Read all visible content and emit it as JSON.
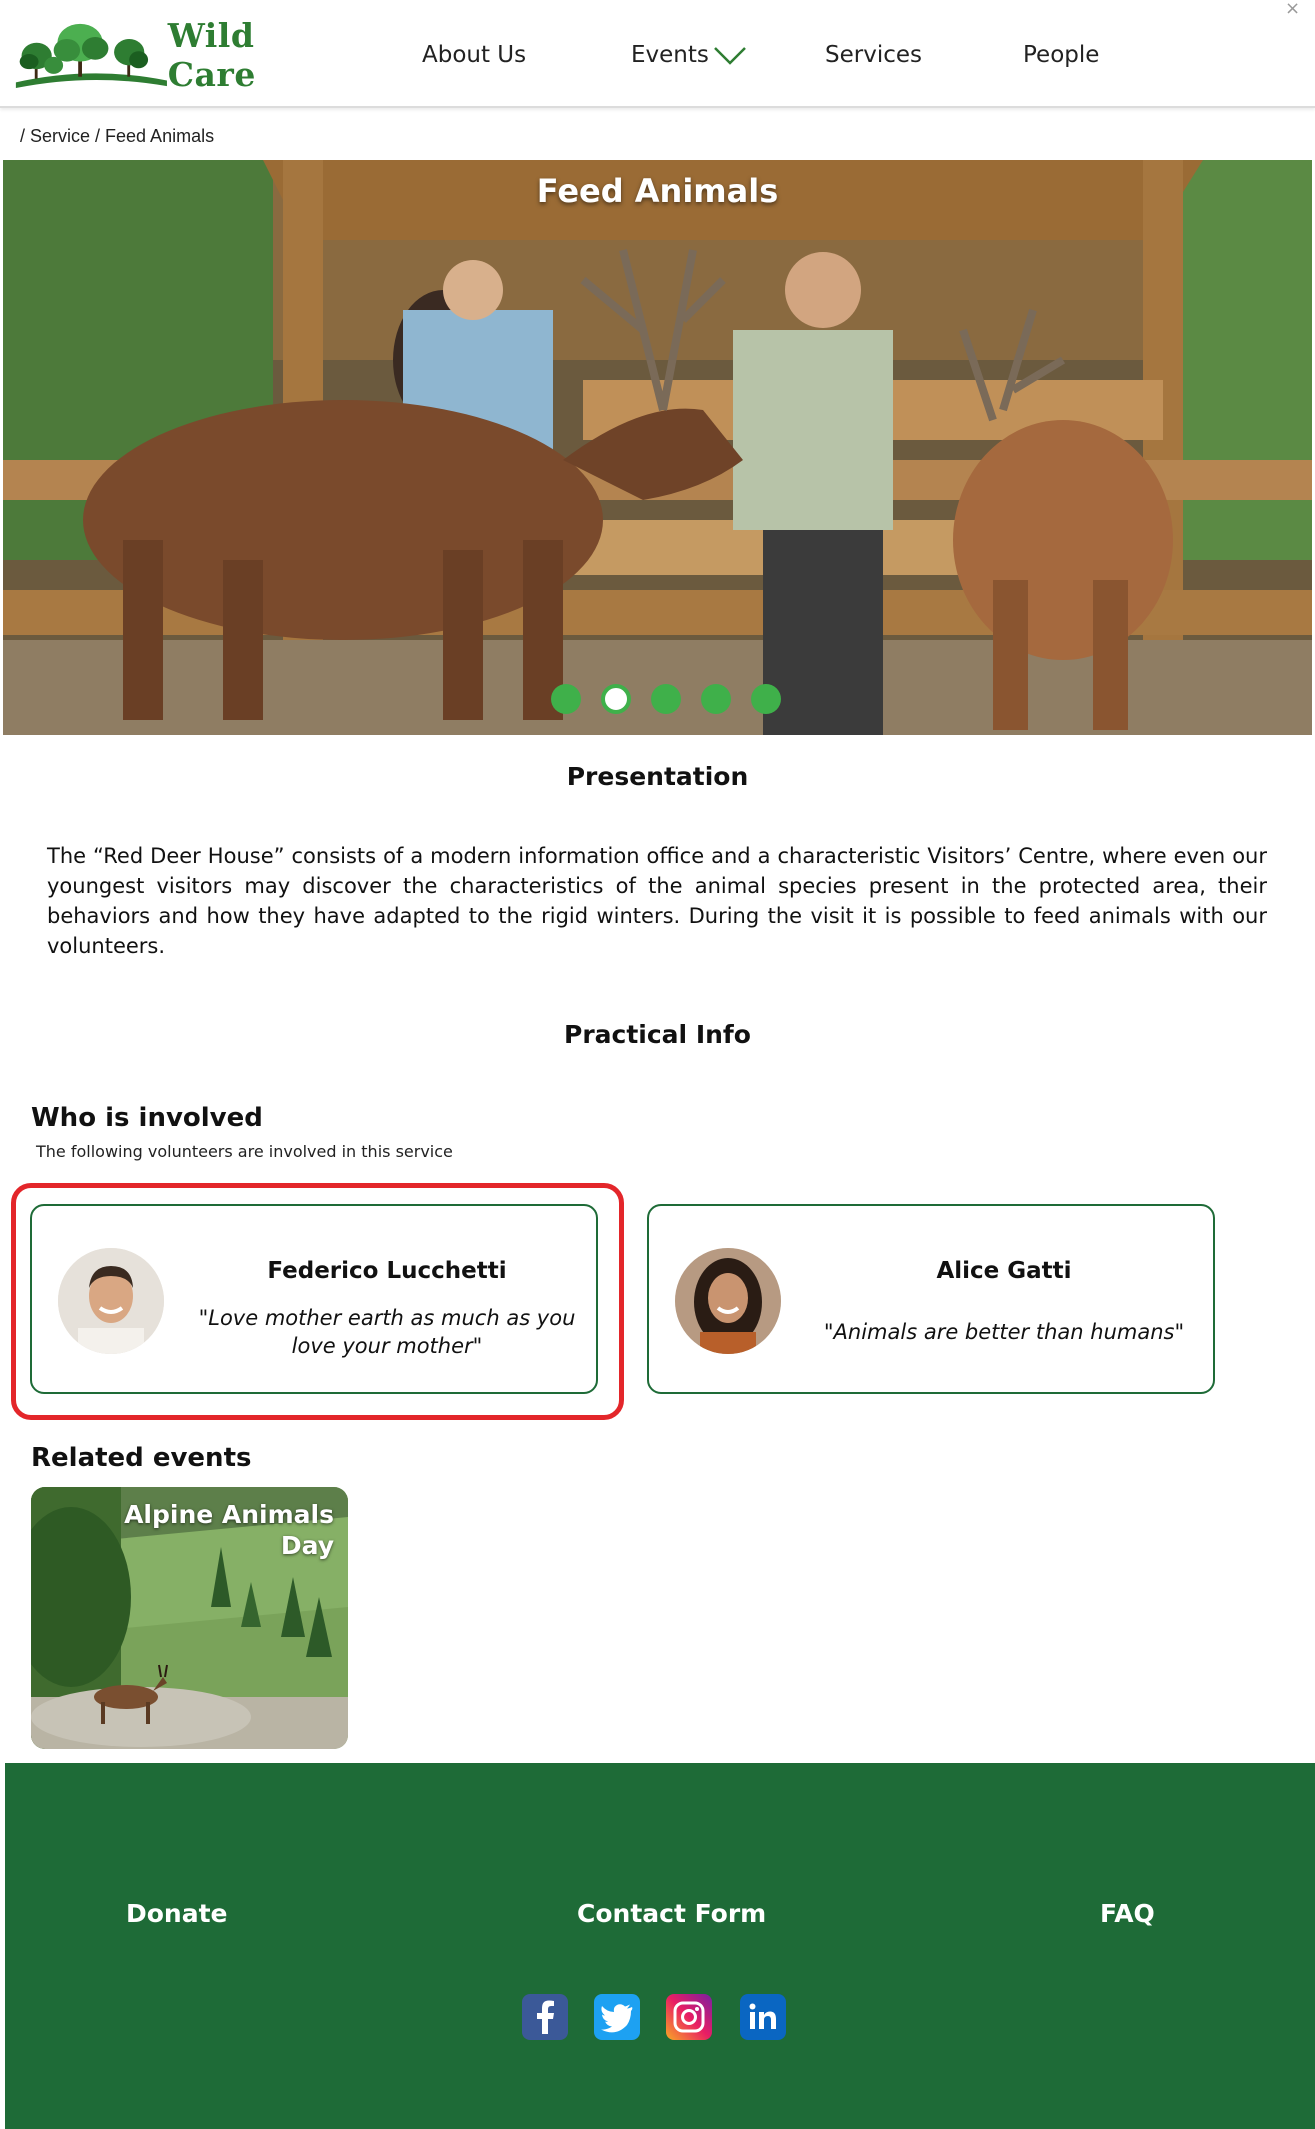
{
  "header": {
    "logo_text": "Wild Care",
    "nav": {
      "about": "About Us",
      "events": "Events",
      "services": "Services",
      "people": "People"
    },
    "close_glyph": "×"
  },
  "breadcrumb": "/ Service / Feed Animals",
  "hero": {
    "title": "Feed Animals",
    "slides_count": 5,
    "active_slide": 2
  },
  "presentation": {
    "heading": "Presentation",
    "text": "The “Red Deer House” consists of a modern information office and a characteristic Visitors’ Centre, where even our youngest visitors may discover the characteristics of the animal species present in the protected area, their behaviors and how they have adapted to the rigid winters. During the visit it is possible to feed animals with our volunteers."
  },
  "practical_info": {
    "heading": "Practical Info"
  },
  "who": {
    "heading": "Who is involved",
    "subtitle": "The following volunteers are involved in this service",
    "people": [
      {
        "name": "Federico Lucchetti",
        "quote": "\"Love mother earth as much as you love your mother\""
      },
      {
        "name": "Alice Gatti",
        "quote": "\"Animals are better than humans\""
      }
    ]
  },
  "related": {
    "heading": "Related events",
    "events": [
      {
        "title": "Alpine Animals Day"
      }
    ]
  },
  "footer": {
    "links": {
      "donate": "Donate",
      "contact": "Contact Form",
      "faq": "FAQ"
    },
    "social": [
      "facebook-icon",
      "twitter-icon",
      "instagram-icon",
      "linkedin-icon"
    ]
  },
  "colors": {
    "brand_green": "#1e6b37",
    "dot_green": "#3fb04a",
    "highlight_red": "#e3262a"
  }
}
